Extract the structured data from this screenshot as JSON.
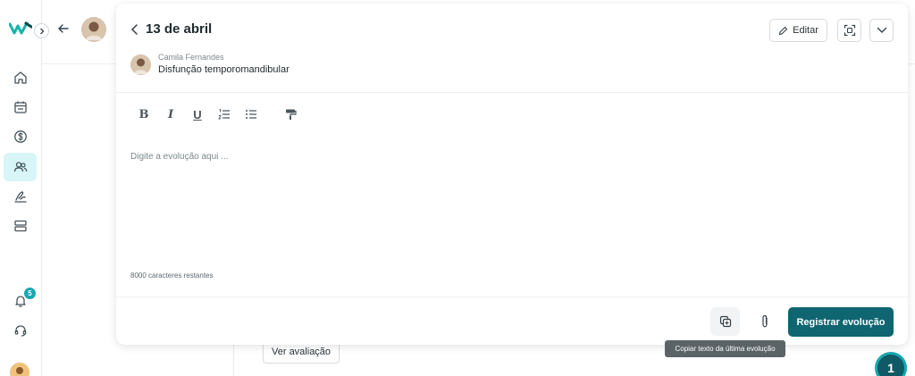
{
  "nav": {
    "items": [
      {
        "name": "home",
        "icon": "home-icon"
      },
      {
        "name": "calendar",
        "icon": "calendar-icon"
      },
      {
        "name": "finance",
        "icon": "money-icon"
      },
      {
        "name": "patients",
        "icon": "users-icon",
        "active": true
      },
      {
        "name": "signature",
        "icon": "signature-icon"
      },
      {
        "name": "records",
        "icon": "stack-icon"
      }
    ],
    "notifications_count": "5"
  },
  "header": {
    "date_title": "13 de abril",
    "edit_label": "Editar"
  },
  "patient": {
    "name": "Camila Fernandes",
    "diagnosis": "Disfunção temporomandibular"
  },
  "editor": {
    "toolbar": [
      "B",
      "I",
      "U",
      "ordered-list",
      "bullet-list",
      "paint-format"
    ],
    "placeholder": "Digite a evolução aqui ...",
    "chars_remaining": "8000 caracteres restantes"
  },
  "footer": {
    "submit_label": "Registrar evolução",
    "copy_tooltip": "Copiar texto da última evolução"
  },
  "background": {
    "view_assessment_label": "Ver avaliação",
    "fab_count": "1"
  },
  "colors": {
    "accent": "#0f6570",
    "accent_light": "#1aa7b0",
    "active_nav_bg": "#d8f5f7"
  }
}
